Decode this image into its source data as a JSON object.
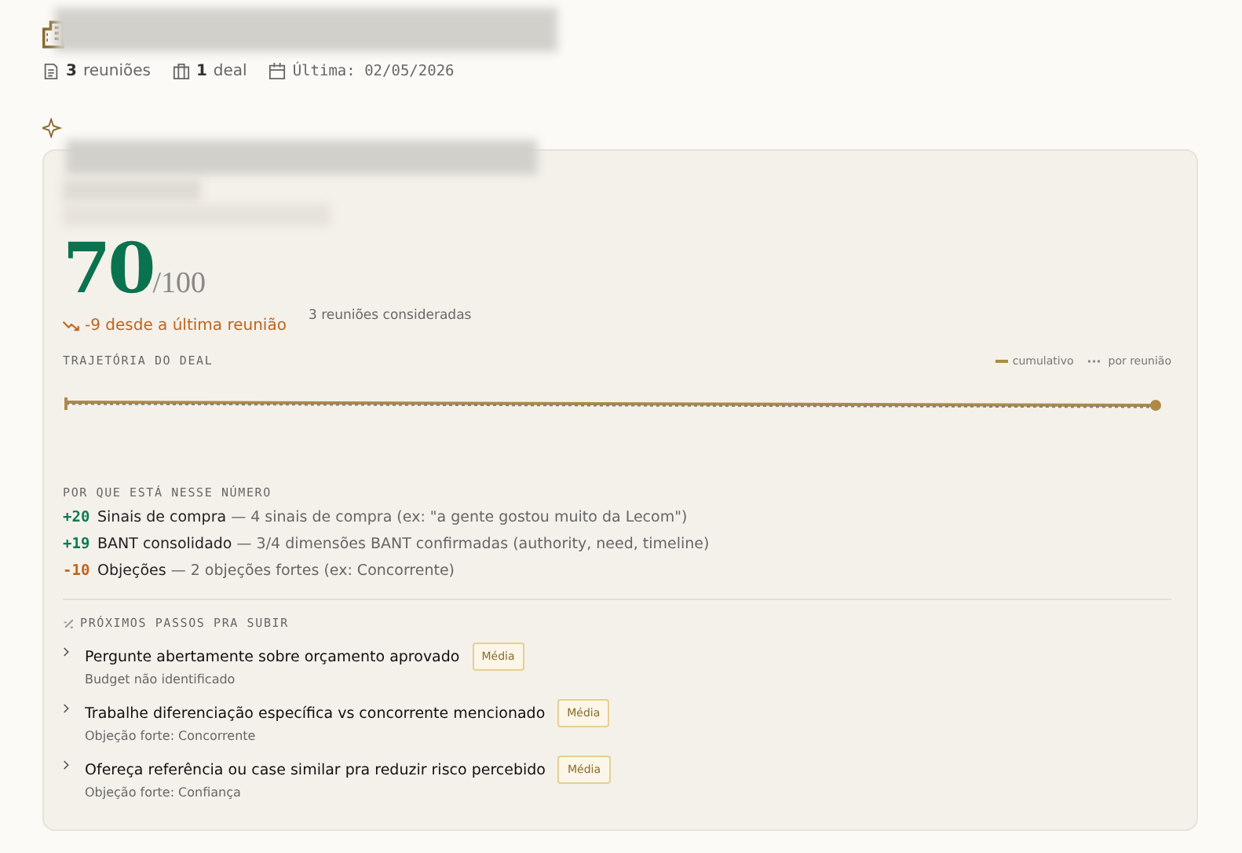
{
  "meta": [
    {
      "kind": "document",
      "count": "3",
      "label": "reuniões"
    },
    {
      "kind": "briefcase",
      "count": "1",
      "label": "deal"
    },
    {
      "kind": "calendar",
      "label": "Última: 02/05/2026"
    }
  ],
  "score": {
    "value": "70",
    "max": "/100",
    "trend": "-9 desde a última reunião",
    "trend_down": true,
    "note": "3 reuniões consideradas"
  },
  "trajectory": {
    "title": "TRAJETÓRIA DO DEAL",
    "legend": [
      "cumulativo",
      "por reunião"
    ]
  },
  "factors": {
    "title": "POR QUE ESTÁ NESSE NÚMERO",
    "items": [
      {
        "kind": "positive",
        "delta": "+20",
        "label": "Sinais de compra",
        "detail": "— 4 sinais de compra (ex: \"a gente gostou muito da Lecom\")"
      },
      {
        "kind": "positive",
        "delta": "+19",
        "label": "BANT consolidado",
        "detail": "— 3/4 dimensões BANT confirmadas (authority, need, timeline)"
      },
      {
        "kind": "negative",
        "delta": "-10",
        "label": "Objeções",
        "detail": "— 2 objeções fortes (ex: Concorrente)"
      }
    ]
  },
  "next_steps": {
    "title": "PRÓXIMOS PASSOS PRA SUBIR",
    "items": [
      {
        "title": "Pergunte abertamente sobre orçamento aprovado",
        "priority": "Média",
        "reason": "Budget não identificado"
      },
      {
        "title": "Trabalhe diferenciação específica vs concorrente mencionado",
        "priority": "Média",
        "reason": "Objeção forte: Concorrente"
      },
      {
        "title": "Ofereça referência ou case similar pra reduzir risco percebido",
        "priority": "Média",
        "reason": "Objeção forte: Confiança"
      }
    ]
  }
}
